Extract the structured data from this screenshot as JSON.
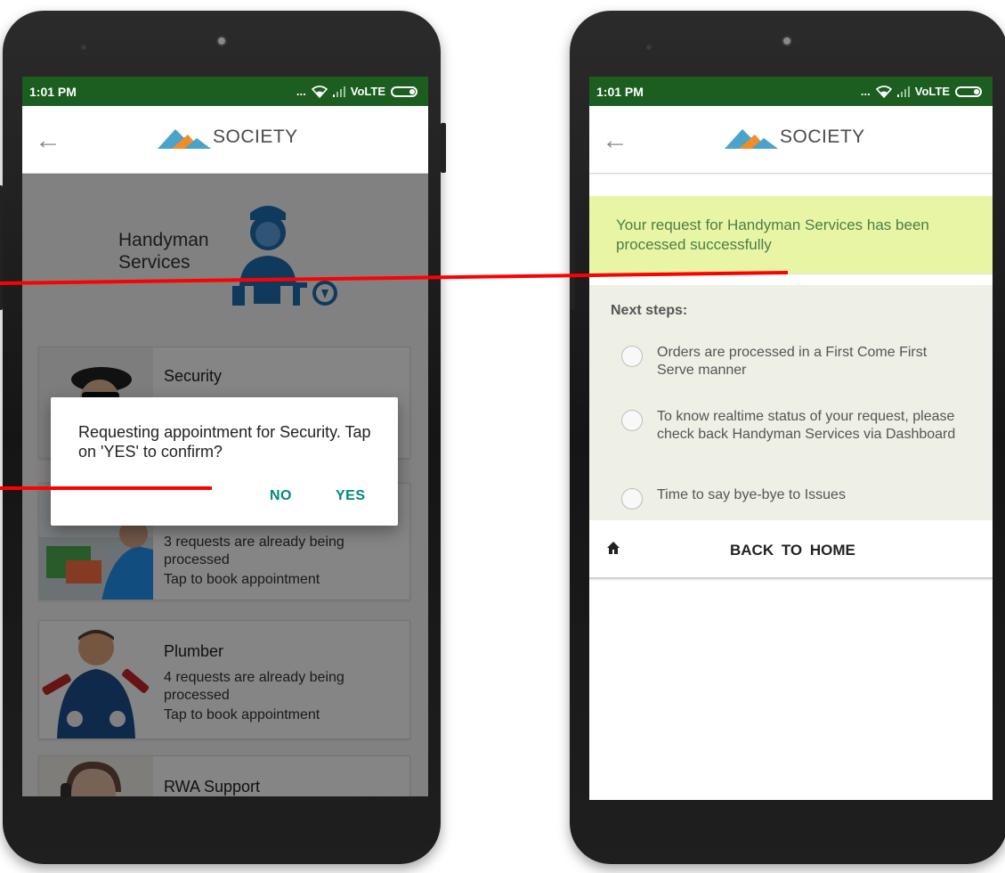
{
  "left_phone": {
    "status": {
      "time": "1:01 PM",
      "signal": "... ",
      "network": "VoLTE"
    },
    "appbar": {
      "logo_text": "SOCIETY"
    },
    "hero": {
      "line1": "Handyman",
      "line2": "Services"
    },
    "services": [
      {
        "title": "Security",
        "line1": "",
        "line2": "",
        "line3": ""
      },
      {
        "title": "",
        "line1": "3 requests are already being",
        "line2": "processed",
        "line3": "Tap to book appointment"
      },
      {
        "title": "Plumber",
        "line1": "4 requests are already being",
        "line2": "processed",
        "line3": "Tap to book appointment"
      },
      {
        "title": "RWA Support",
        "line1": "",
        "line2": "",
        "line3": ""
      }
    ],
    "dialog": {
      "message": "Requesting appointment for Security. Tap on 'YES' to confirm?",
      "no_label": "NO",
      "yes_label": "YES"
    }
  },
  "right_phone": {
    "status": {
      "time": "1:01 PM",
      "signal": "... ",
      "network": "VoLTE"
    },
    "appbar": {
      "logo_text": "SOCIETY"
    },
    "success_message": "Your request for Handyman Services has been processed successfully",
    "next_steps_title": "Next steps:",
    "steps": [
      "Orders are processed in a First Come First Serve manner",
      "To know realtime status of your request, please check back Handyman Services via Dashboard",
      "Time to say bye-bye to Issues"
    ],
    "home_label": "BACK  TO  HOME"
  },
  "colors": {
    "status_bar": "#1b5e20",
    "dialog_button": "#00897b",
    "success_bg": "#e8f5a5",
    "success_text": "#4a7f46",
    "steps_bg": "#eef0e6",
    "connector": "#ff0000",
    "logo_blue": "#4aa3c8",
    "logo_orange": "#f28c28"
  },
  "icons": [
    "back-arrow-icon",
    "wifi-icon",
    "battery-icon",
    "society-logo-icon",
    "handyman-icon",
    "home-icon",
    "radio-icon"
  ]
}
